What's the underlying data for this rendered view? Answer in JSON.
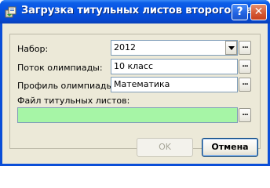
{
  "window": {
    "title": "Загрузка титульных листов второго этапа"
  },
  "titlebar_buttons": {
    "help": "?",
    "close": "✕"
  },
  "form": {
    "nabor": {
      "label": "Набор:",
      "value": "2012",
      "browse": "..."
    },
    "potok": {
      "label": "Поток олимпиады:",
      "value": "10 класс",
      "browse": "..."
    },
    "profil": {
      "label": "Профиль олимпиады:",
      "value": "Математика",
      "browse": "..."
    },
    "file": {
      "label": "Файл титульных листов:",
      "value": "",
      "browse": "..."
    }
  },
  "buttons": {
    "ok": "OK",
    "cancel": "Отмена"
  },
  "colors": {
    "file_field_bg": "#a6f5a6",
    "titlebar": "#0552e2",
    "face": "#ece9d8"
  }
}
